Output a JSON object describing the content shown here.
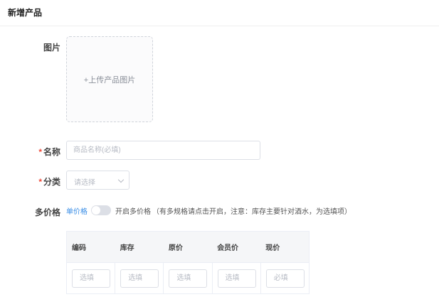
{
  "header": {
    "title": "新增产品"
  },
  "form": {
    "image": {
      "label": "图片",
      "upload_text": "+上传产品图片"
    },
    "name": {
      "required_mark": "*",
      "label": "名称",
      "placeholder": "商品名称(必填)"
    },
    "category": {
      "required_mark": "*",
      "label": "分类",
      "placeholder": "请选择"
    },
    "multi_price": {
      "label": "多价格",
      "switch_off_label": "单价格",
      "switch_on_label": "开启多价格",
      "hint": "（有多规格请点击开启，注意：库存主要针对酒水，为选填项）",
      "enabled": false
    }
  },
  "spec_table": {
    "columns": [
      "编码",
      "库存",
      "原价",
      "会员价",
      "现价"
    ],
    "placeholders": [
      "选填",
      "选填",
      "选填",
      "选填",
      "必填"
    ]
  },
  "colors": {
    "accent": "#3a8ee6",
    "required": "#f04a3a",
    "border": "#dcdfe6"
  }
}
